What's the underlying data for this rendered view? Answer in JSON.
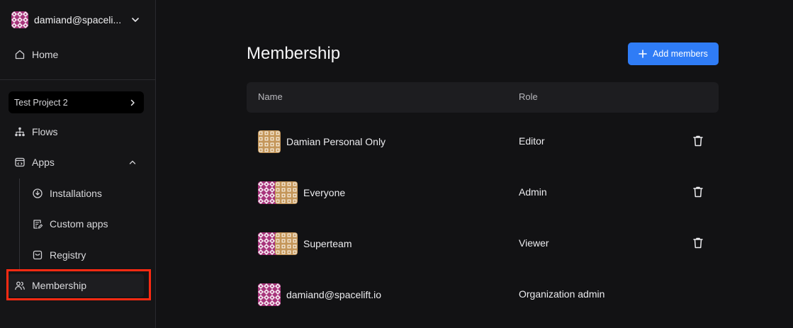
{
  "sidebar": {
    "account_name": "damiand@spaceli...",
    "home_label": "Home",
    "project_label": "Test Project 2",
    "flows_label": "Flows",
    "apps_label": "Apps",
    "installations_label": "Installations",
    "custom_apps_label": "Custom apps",
    "registry_label": "Registry",
    "membership_label": "Membership"
  },
  "main": {
    "title": "Membership",
    "add_button_label": "Add members",
    "columns": {
      "name": "Name",
      "role": "Role"
    },
    "rows": [
      {
        "name": "Damian Personal Only",
        "role": "Editor",
        "avatars": [
          "gold"
        ],
        "deletable": true
      },
      {
        "name": "Everyone",
        "role": "Admin",
        "avatars": [
          "magenta",
          "gold"
        ],
        "deletable": true
      },
      {
        "name": "Superteam",
        "role": "Viewer",
        "avatars": [
          "magenta",
          "gold"
        ],
        "deletable": true
      },
      {
        "name": "damiand@spacelift.io",
        "role": "Organization admin",
        "avatars": [
          "magenta"
        ],
        "deletable": false
      }
    ]
  },
  "colors": {
    "accent": "#2f7cf6",
    "highlight": "#ff2a12",
    "avatar_magenta": "#a8357c",
    "avatar_gold": "#c4965a"
  }
}
